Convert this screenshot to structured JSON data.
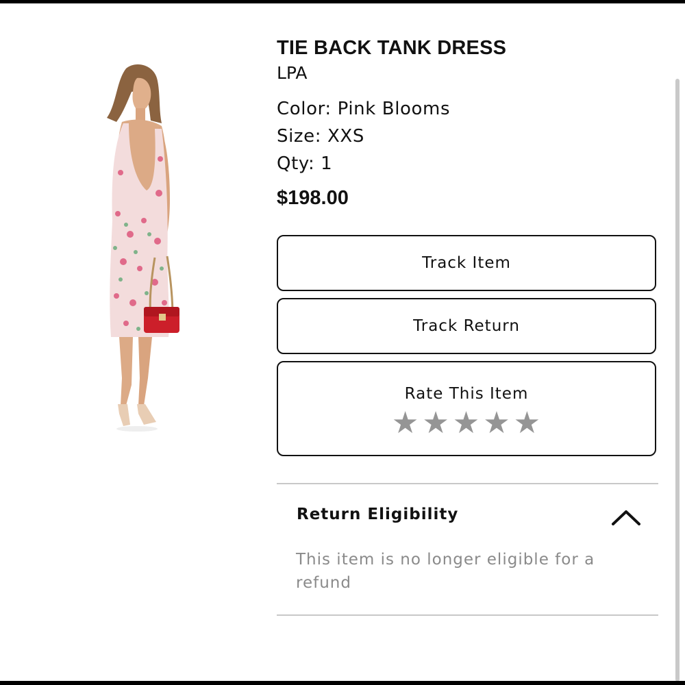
{
  "product": {
    "title": "TIE BACK TANK DRESS",
    "brand": "LPA",
    "color": "Color: Pink Blooms",
    "size": "Size: XXS",
    "qty": "Qty: 1",
    "price": "$198.00"
  },
  "actions": {
    "track_item": "Track Item",
    "track_return": "Track Return",
    "rate_label": "Rate This Item",
    "rating_stars": 5,
    "rating_filled": 0
  },
  "return_section": {
    "title": "Return Eligibility",
    "message": "This item is no longer eligible for a refund",
    "expanded": true
  },
  "colors": {
    "star_gray": "#959595",
    "text_muted": "#8a8a8a",
    "divider": "#c8c8c8"
  }
}
